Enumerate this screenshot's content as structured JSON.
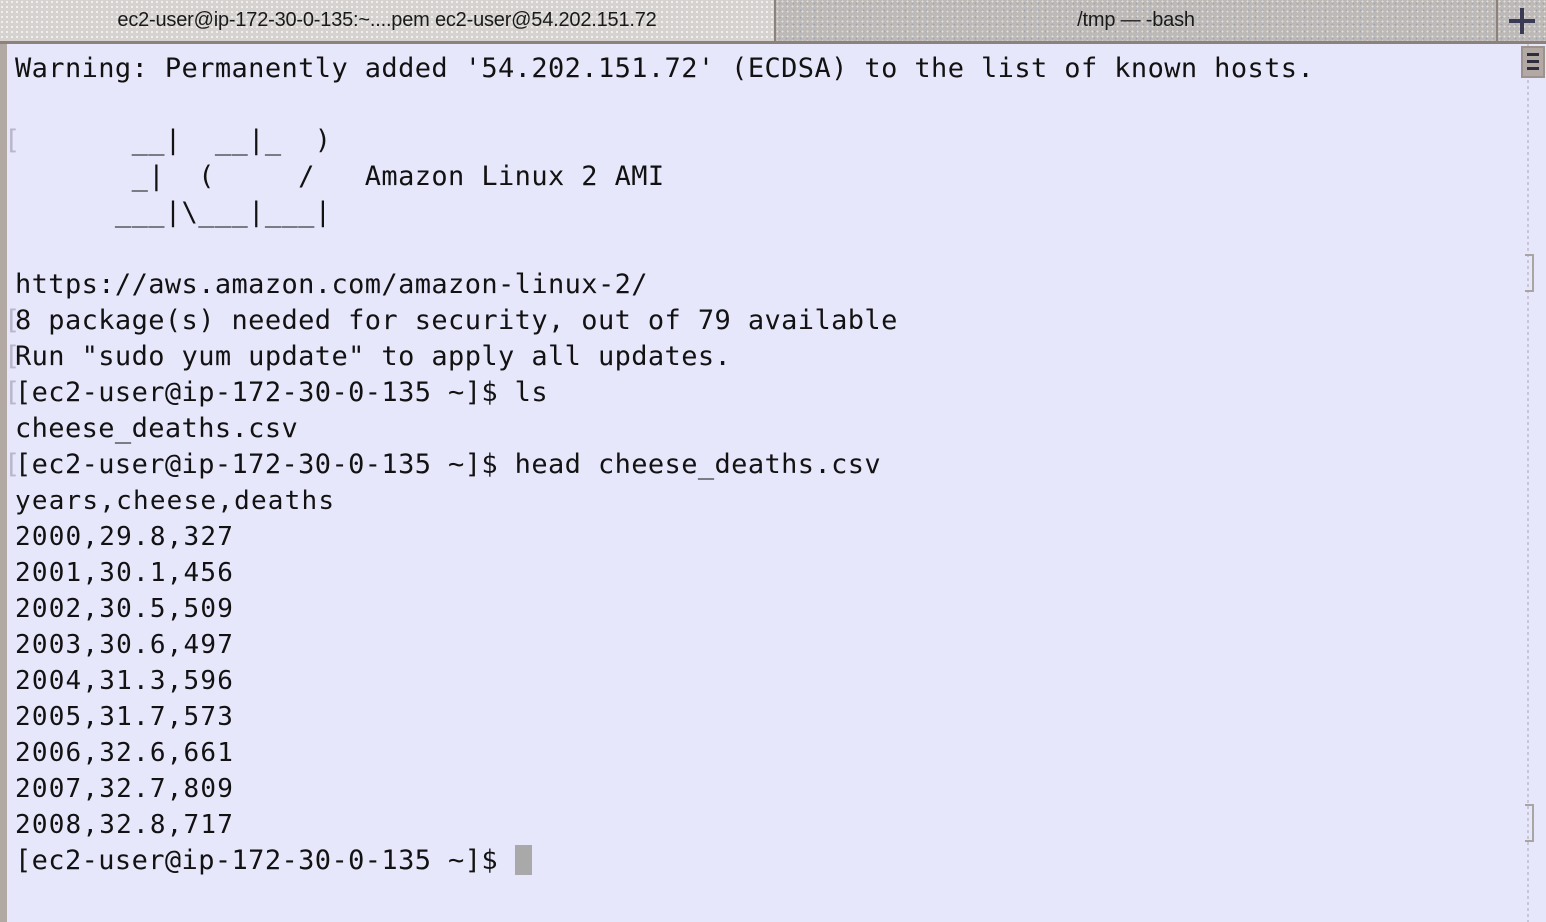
{
  "window": {
    "background_color": "#e7e7fb",
    "chrome_color": "#c3bfbc"
  },
  "tabbar": {
    "tabs": [
      {
        "label": "ec2-user@ip-172-30-0-135:~....pem ec2-user@54.202.151.72",
        "active": true
      },
      {
        "label": "/tmp — -bash",
        "active": false
      }
    ],
    "new_tab_label": "+"
  },
  "terminal": {
    "prompt": "[ec2-user@ip-172-30-0-135 ~]$ ",
    "lines": [
      {
        "text": "Warning: Permanently added '54.202.151.72' (ECDSA) to the list of known hosts.",
        "mark": false
      },
      {
        "text": "",
        "mark": false
      },
      {
        "text": "       __|  __|_  )",
        "mark": true
      },
      {
        "text": "       _|  (     /   Amazon Linux 2 AMI",
        "mark": false
      },
      {
        "text": "      ___|\\___|___|",
        "mark": false
      },
      {
        "text": "",
        "mark": false
      },
      {
        "text": "https://aws.amazon.com/amazon-linux-2/",
        "mark": false
      },
      {
        "text": "8 package(s) needed for security, out of 79 available",
        "mark": true
      },
      {
        "text": "Run \"sudo yum update\" to apply all updates.",
        "mark": true
      },
      {
        "text": "[ec2-user@ip-172-30-0-135 ~]$ ls",
        "mark": true
      },
      {
        "text": "cheese_deaths.csv",
        "mark": false
      },
      {
        "text": "[ec2-user@ip-172-30-0-135 ~]$ head cheese_deaths.csv",
        "mark": true
      }
    ],
    "csv_lines": [
      "years,cheese,deaths",
      "2000,29.8,327",
      "2001,30.1,456",
      "2002,30.5,509",
      "2003,30.6,497",
      "2004,31.3,596",
      "2005,31.7,573",
      "2006,32.6,661",
      "2007,32.7,809",
      "2008,32.8,717"
    ],
    "final_prompt": "[ec2-user@ip-172-30-0-135 ~]$ ",
    "cursor_visible": true,
    "commands": [
      "ls",
      "head cheese_deaths.csv"
    ],
    "file_name": "cheese_deaths.csv",
    "host": "ip-172-30-0-135",
    "user": "ec2-user",
    "remote_ip": "54.202.151.72",
    "os": "Amazon Linux 2 AMI",
    "os_url": "https://aws.amazon.com/amazon-linux-2/",
    "security_packages": "8",
    "available_packages": "79"
  },
  "scrollbar": {
    "thumb_position": "top"
  }
}
